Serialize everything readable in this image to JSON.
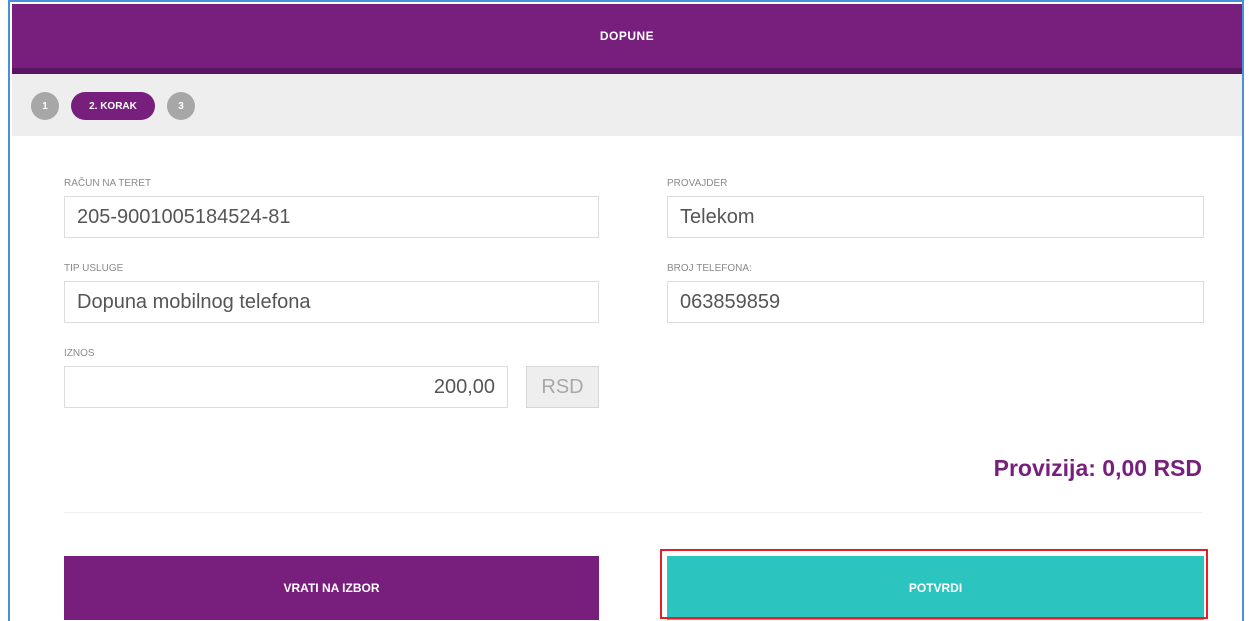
{
  "header": {
    "title": "DOPUNE"
  },
  "steps": [
    {
      "label": "1",
      "active": false
    },
    {
      "label": "2. KORAK",
      "active": true
    },
    {
      "label": "3",
      "active": false
    }
  ],
  "form": {
    "account": {
      "label": "RAČUN NA TERET",
      "value": "205-9001005184524-81"
    },
    "provider": {
      "label": "PROVAJDER",
      "value": "Telekom"
    },
    "service_type": {
      "label": "TIP USLUGE",
      "value": "Dopuna mobilnog telefona"
    },
    "phone": {
      "label": "BROJ TELEFONA:",
      "value": "063859859"
    },
    "amount": {
      "label": "IZNOS",
      "value": "200,00",
      "currency": "RSD"
    }
  },
  "fee": {
    "text": "Provizija: 0,00 RSD"
  },
  "actions": {
    "back_label": "VRATI NA IZBOR",
    "confirm_label": "POTVRDI"
  },
  "colors": {
    "brand_purple": "#781f7e",
    "confirm_teal": "#2bc4be",
    "highlight_red": "#e3202a"
  }
}
